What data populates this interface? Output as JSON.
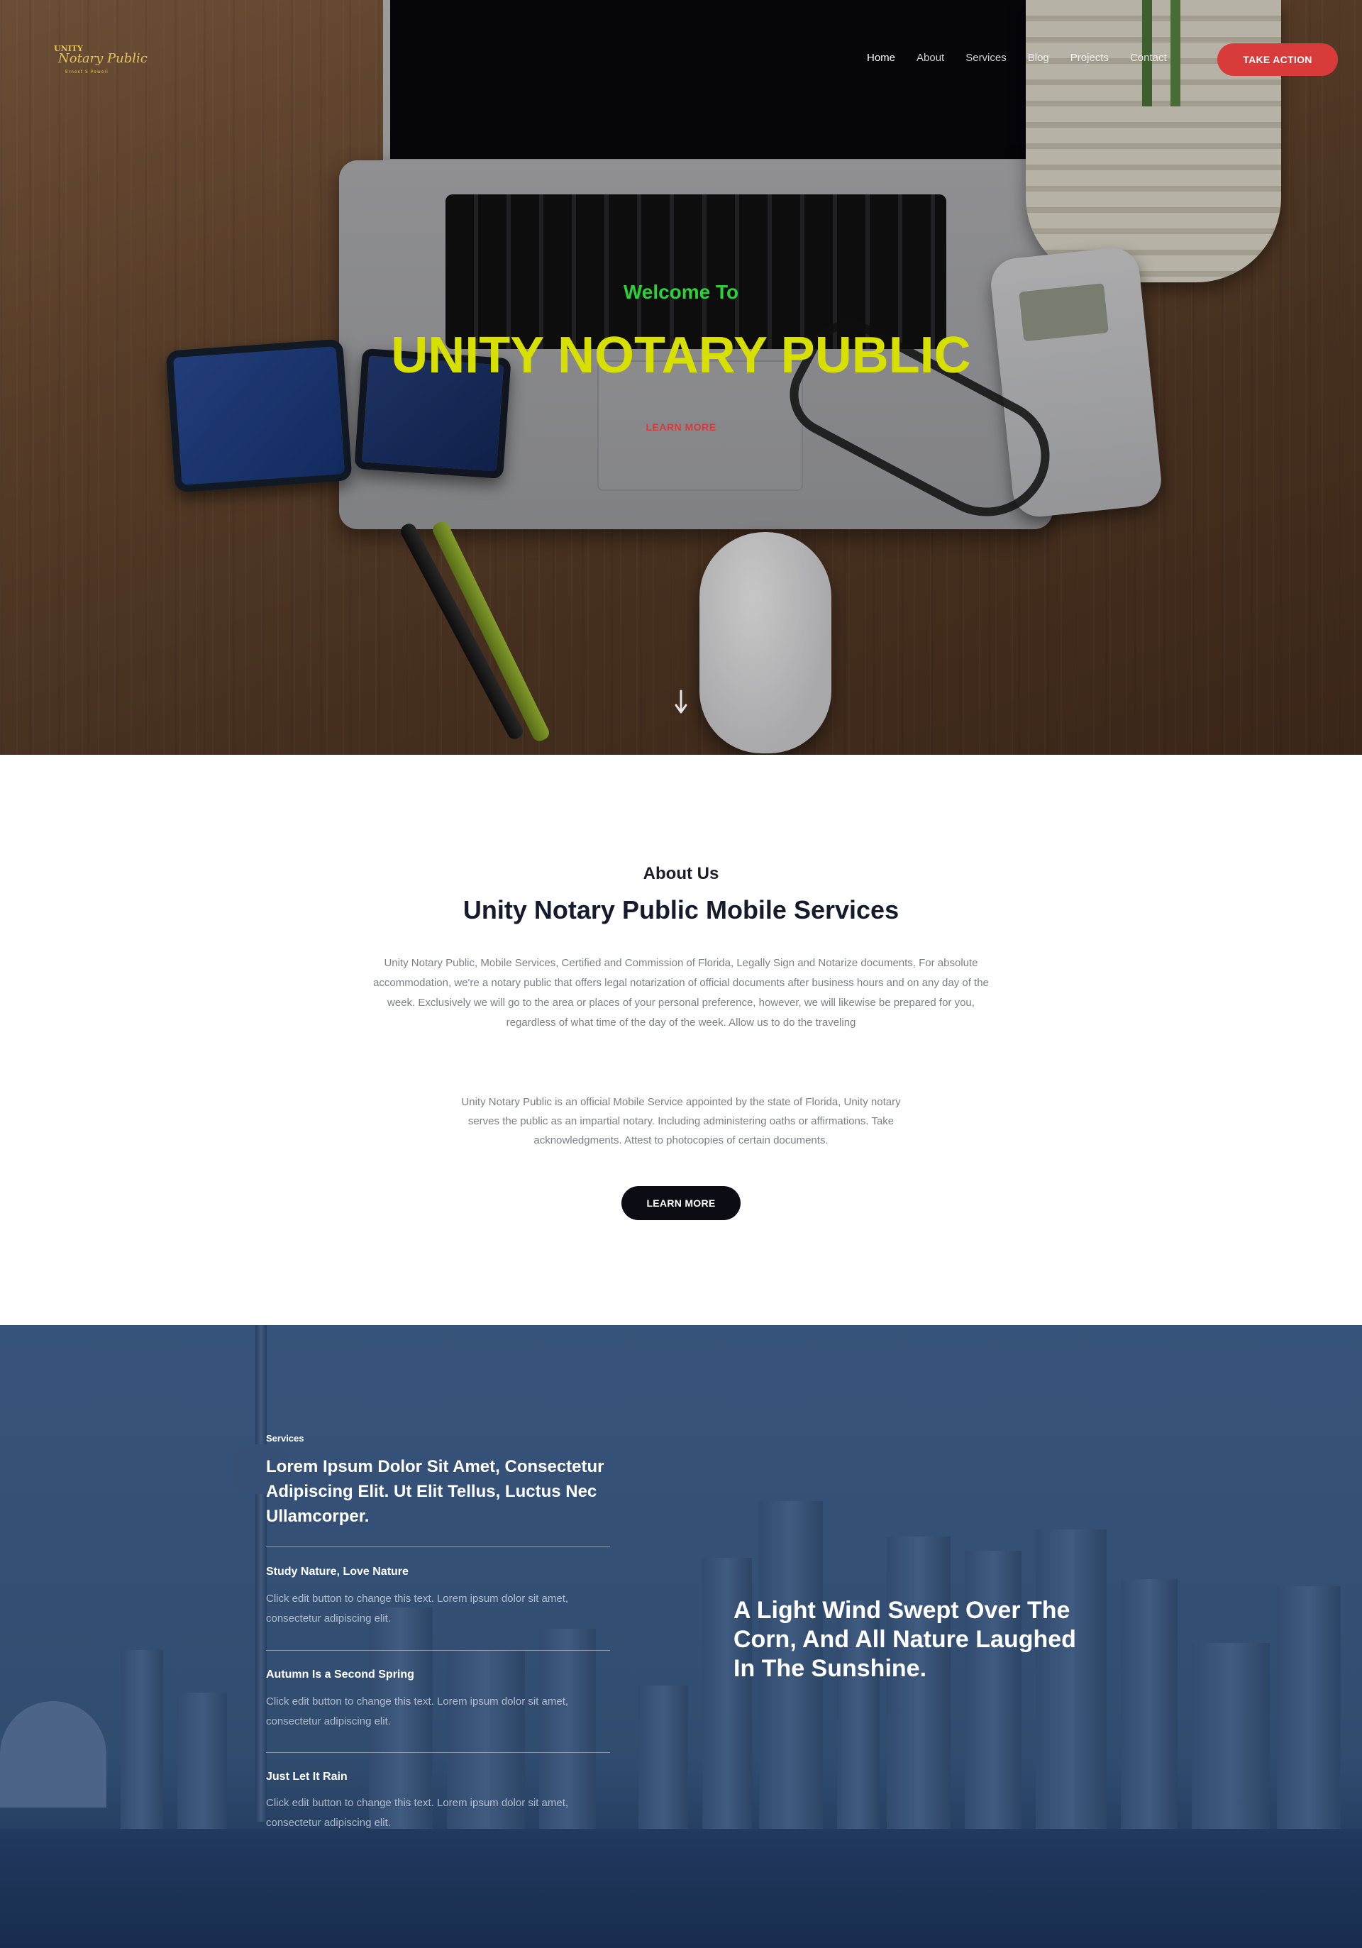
{
  "header": {
    "logo": {
      "top_text": "UNITY",
      "main_text": "Notary Public",
      "sub_text": "Ernest S Powell"
    },
    "nav": [
      "Home",
      "About",
      "Services",
      "Blog",
      "Projects",
      "Contact"
    ],
    "active_nav": "Home",
    "cta_label": "TAKE ACTION"
  },
  "hero": {
    "welcome": "Welcome To",
    "title": "UNITY NOTARY PUBLIC",
    "learn_more": "LEARN MORE",
    "scroll_icon": "arrow-down-icon"
  },
  "about": {
    "eyebrow": "About Us",
    "title": "Unity Notary Public Mobile Services",
    "paragraph1": "Unity Notary Public, Mobile Services, Certified and Commission of Florida, Legally Sign and Notarize documents, For absolute accommodation, we're a notary public that offers legal notarization of official documents after business hours and on any day of the week. Exclusively we will go to the area or places of your personal preference, however, we will likewise be prepared for you, regardless of what time of the day of the week. Allow us to do the traveling",
    "paragraph2": "Unity Notary Public is an official Mobile Service appointed by the state of Florida, Unity notary serves the public as an impartial notary. Including administering oaths or affirmations. Take acknowledgments. Attest to photocopies of certain documents.",
    "button": "LEARN MORE"
  },
  "services": {
    "eyebrow": "Services",
    "title": "Lorem Ipsum Dolor Sit Amet, Consectetur Adipiscing Elit. Ut Elit Tellus, Luctus Nec Ullamcorper.",
    "items": [
      {
        "title": "Study Nature, Love Nature",
        "text": "Click edit button to change this text. Lorem ipsum dolor sit amet, consectetur adipiscing elit."
      },
      {
        "title": "Autumn Is a Second Spring",
        "text": "Click edit button to change this text. Lorem ipsum dolor sit amet, consectetur adipiscing elit."
      },
      {
        "title": "Just Let It Rain",
        "text": "Click edit button to change this text. Lorem ipsum dolor sit amet, consectetur adipiscing elit."
      }
    ],
    "quote": "A Light Wind Swept Over The Corn, And All Nature Laughed In The Sunshine."
  },
  "colors": {
    "accent_red": "#d93a3a",
    "hero_title": "#d7e000",
    "hero_welcome": "#2ed03a",
    "dark_button": "#0c0d14",
    "heading_dark": "#141b2d",
    "body_gray": "#7b7f86"
  }
}
